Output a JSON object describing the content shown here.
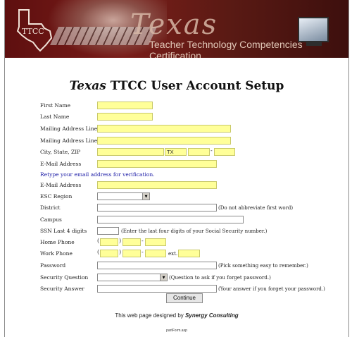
{
  "banner": {
    "title": "Texas",
    "subtitle": "Teacher Technology Competencies Certification",
    "logo_text": "TTCC"
  },
  "page": {
    "title_italic": "Texas",
    "title_rest": "TTCC User Account Setup"
  },
  "form": {
    "first_name": "First Name",
    "last_name": "Last Name",
    "address1": "Mailing Address Line 1",
    "address2": "Mailing Address Line 2",
    "city_state_zip": "City, State, ZIP",
    "state_value": "TX",
    "email": "E-Mail Address",
    "retype_note": "Retype your email address for verification.",
    "email_confirm": "E-Mail Address",
    "esc_region": "ESC Region",
    "district": "District",
    "district_note": "(Do not abbreviate first word)",
    "campus": "Campus",
    "ssn": "SSN Last 4 digits",
    "ssn_note": "(Enter the last four digits of your Social Security number.)",
    "home_phone": "Home Phone",
    "work_phone": "Work Phone",
    "ext": "ext.",
    "password": "Password",
    "password_note": "(Pick something easy to remember.)",
    "security_question": "Security Question",
    "security_question_note": "(Question to ask if you forget password.)",
    "security_answer": "Security Answer",
    "security_answer_note": "(Your answer if you forget your password.)",
    "continue_label": "Continue"
  },
  "credit": {
    "prefix": "This web page designed by",
    "company": "Synergy Consulting"
  },
  "footer": {
    "filename": "partForm.asp"
  },
  "colors": {
    "required_field": "#ffff99",
    "banner": "#6a1a16",
    "link_blue": "#1a1aa6"
  }
}
